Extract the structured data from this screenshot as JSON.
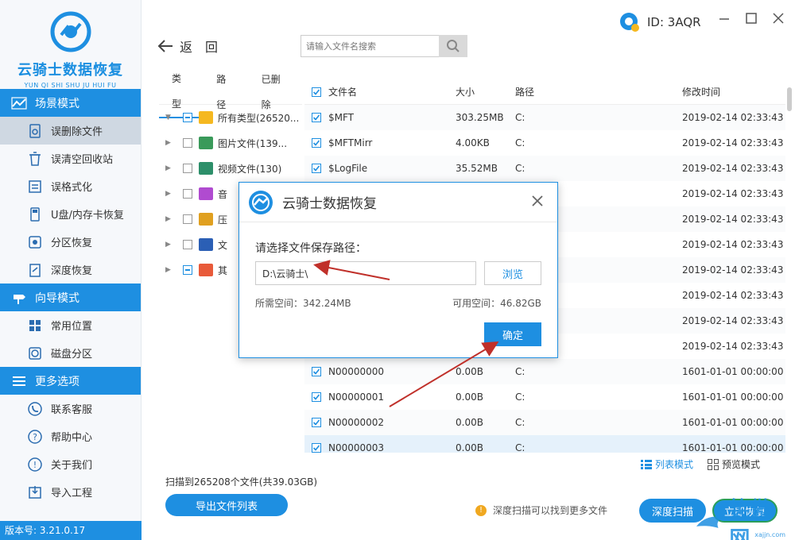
{
  "app": {
    "name": "云骑士数据恢复",
    "pinyin": "YUN QI SHI SHU JU HUI FU",
    "user_id": "ID: 3AQR",
    "version": "版本号: 3.21.0.17"
  },
  "sidebar": {
    "sections": [
      {
        "title": "场景模式",
        "items": [
          {
            "label": "误删除文件",
            "icon": "file-recover-icon",
            "active": true
          },
          {
            "label": "误清空回收站",
            "icon": "recycle-bin-icon"
          },
          {
            "label": "误格式化",
            "icon": "format-icon"
          },
          {
            "label": "U盘/内存卡恢复",
            "icon": "usb-icon"
          },
          {
            "label": "分区恢复",
            "icon": "partition-icon"
          },
          {
            "label": "深度恢复",
            "icon": "deep-recover-icon"
          }
        ]
      },
      {
        "title": "向导模式",
        "items": [
          {
            "label": "常用位置",
            "icon": "windows-icon"
          },
          {
            "label": "磁盘分区",
            "icon": "disk-icon"
          }
        ]
      },
      {
        "title": "更多选项",
        "items": [
          {
            "label": "联系客服",
            "icon": "phone-icon"
          },
          {
            "label": "帮助中心",
            "icon": "help-icon"
          },
          {
            "label": "关于我们",
            "icon": "info-icon"
          },
          {
            "label": "导入工程",
            "icon": "import-icon"
          }
        ]
      }
    ]
  },
  "topbar": {
    "back_label": "返　回",
    "search_placeholder": "请输入文件名搜索"
  },
  "tree": {
    "tabs": [
      "类型",
      "路径",
      "已删除"
    ],
    "rows": [
      {
        "label": "所有类型(26520...",
        "expanded": true,
        "state": "partial",
        "color": "#f5b820",
        "icon": "folder-icon"
      },
      {
        "label": "图片文件(139...",
        "state": "empty",
        "color": "#3a9a5a",
        "icon": "image-icon"
      },
      {
        "label": "视频文件(130)",
        "state": "empty",
        "color": "#2d8f6a",
        "icon": "video-icon"
      },
      {
        "label": "音",
        "state": "empty",
        "color": "#b04bd0",
        "icon": "music-icon"
      },
      {
        "label": "压",
        "state": "empty",
        "color": "#e0a020",
        "icon": "archive-icon"
      },
      {
        "label": "文",
        "state": "empty",
        "color": "#2b5fb5",
        "icon": "document-icon"
      },
      {
        "label": "其",
        "state": "partial",
        "color": "#e85a3a",
        "icon": "other-icon"
      }
    ]
  },
  "files": {
    "columns": [
      "文件名",
      "大小",
      "路径",
      "修改时间"
    ],
    "rows": [
      {
        "name": "$MFT",
        "size": "303.25MB",
        "path": "C:",
        "time": "2019-02-14 02:33:43"
      },
      {
        "name": "$MFTMirr",
        "size": "4.00KB",
        "path": "C:",
        "time": "2019-02-14 02:33:43"
      },
      {
        "name": "$LogFile",
        "size": "35.52MB",
        "path": "C:",
        "time": "2019-02-14 02:33:43"
      },
      {
        "name": "",
        "size": "",
        "path": "",
        "time": "2019-02-14 02:33:43"
      },
      {
        "name": "",
        "size": "",
        "path": "",
        "time": "2019-02-14 02:33:43"
      },
      {
        "name": "",
        "size": "",
        "path": "",
        "time": "2019-02-14 02:33:43"
      },
      {
        "name": "",
        "size": "",
        "path": "",
        "time": "2019-02-14 02:33:43"
      },
      {
        "name": "",
        "size": "",
        "path": "",
        "time": "2019-02-14 02:33:43"
      },
      {
        "name": "",
        "size": "",
        "path": "",
        "time": "2019-02-14 02:33:43"
      },
      {
        "name": "",
        "size": "",
        "path": "",
        "time": "2019-02-14 02:33:43"
      },
      {
        "name": "N00000000",
        "size": "0.00B",
        "path": "C:",
        "time": "1601-01-01 00:00:00"
      },
      {
        "name": "N00000001",
        "size": "0.00B",
        "path": "C:",
        "time": "1601-01-01 00:00:00"
      },
      {
        "name": "N00000002",
        "size": "0.00B",
        "path": "C:",
        "time": "1601-01-01 00:00:00"
      },
      {
        "name": "N00000003",
        "size": "0.00B",
        "path": "C:",
        "time": "1601-01-01 00:00:00",
        "highlight": true
      }
    ]
  },
  "bottom": {
    "list_mode": "列表模式",
    "preview_mode": "预览模式",
    "scan_info": "扫描到265208个文件(共39.03GB)",
    "export_label": "导出文件列表",
    "deep_hint": "深度扫描可以找到更多文件",
    "deep_scan_label": "深度扫描",
    "recover_label": "立即恢复",
    "watermark": "笑傲网",
    "watermark_url": "xajjn.com"
  },
  "dialog": {
    "title": "云骑士数据恢复",
    "prompt": "请选择文件保存路径：",
    "path_value": "D:\\云骑士\\",
    "browse_label": "浏览",
    "required_space": "所需空间：342.24MB",
    "free_space": "可用空间：46.82GB",
    "ok_label": "确定"
  },
  "colors": {
    "brand": "#1e8fe1",
    "annotation": "#c0302a"
  }
}
